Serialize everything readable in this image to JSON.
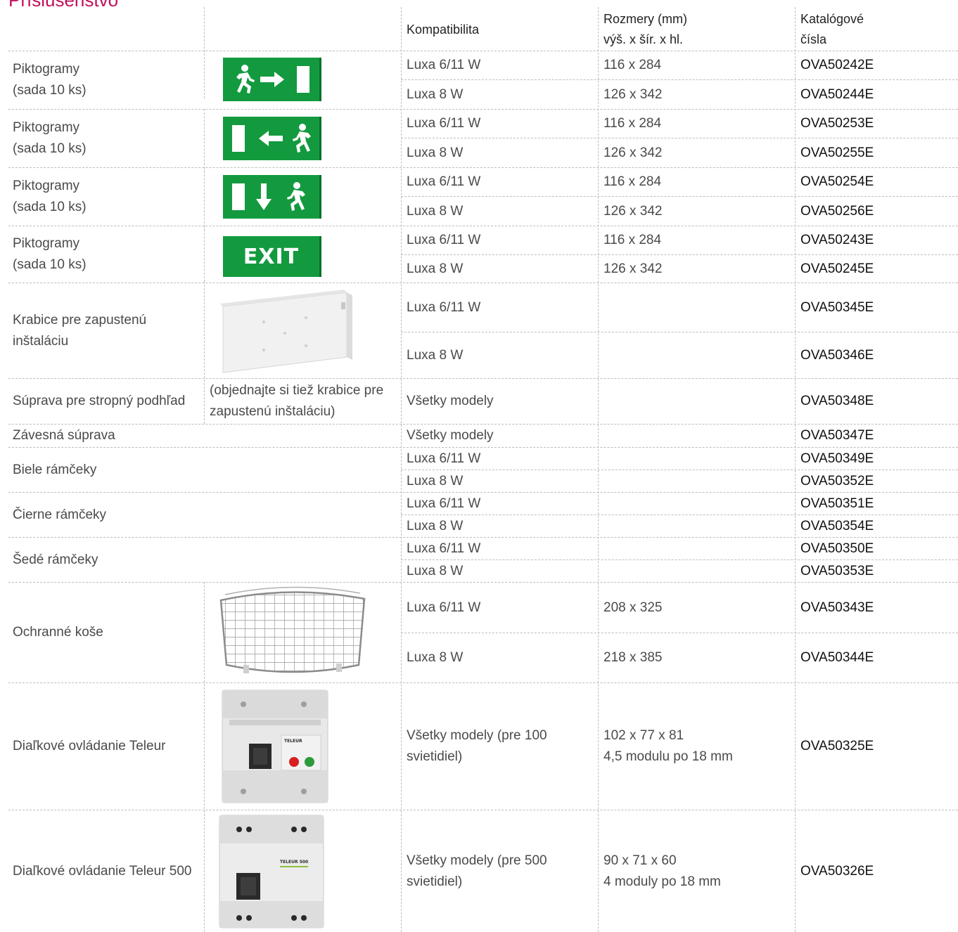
{
  "heading": "Príslušenstvo",
  "colors": {
    "accent": "#c4105a",
    "sign_green": "#139a3f"
  },
  "headers": {
    "compat": "Kompatibilita",
    "dims_line1": "Rozmery (mm)",
    "dims_line2": "výš. x šír. x hl.",
    "cat_line1": "Katalógové",
    "cat_line2": "čísla"
  },
  "groups": {
    "pict_right": {
      "name": "Piktogramy\n(sada 10 ks)",
      "icon": "exit-sign-run-right-icon",
      "rows": [
        {
          "compat": "Luxa 6/11 W",
          "dims": "116 x 284",
          "code": "OVA50242E"
        },
        {
          "compat": "Luxa 8 W",
          "dims": "126 x 342",
          "code": "OVA50244E"
        }
      ]
    },
    "pict_left": {
      "name": "Piktogramy\n(sada 10 ks)",
      "icon": "exit-sign-run-left-icon",
      "rows": [
        {
          "compat": "Luxa 6/11 W",
          "dims": "116 x 284",
          "code": "OVA50253E"
        },
        {
          "compat": "Luxa 8 W",
          "dims": "126 x 342",
          "code": "OVA50255E"
        }
      ]
    },
    "pict_down": {
      "name": "Piktogramy\n(sada 10 ks)",
      "icon": "exit-sign-down-icon",
      "rows": [
        {
          "compat": "Luxa 6/11 W",
          "dims": "116 x 284",
          "code": "OVA50254E"
        },
        {
          "compat": "Luxa 8 W",
          "dims": "126 x 342",
          "code": "OVA50256E"
        }
      ]
    },
    "pict_exit": {
      "name": "Piktogramy\n(sada 10 ks)",
      "sign_text": "EXIT",
      "rows": [
        {
          "compat": "Luxa 6/11 W",
          "dims": "116 x 284",
          "code": "OVA50243E"
        },
        {
          "compat": "Luxa 8 W",
          "dims": "126 x 342",
          "code": "OVA50245E"
        }
      ]
    },
    "krabice": {
      "name": "Krabice pre zapustenú\ninštaláciu",
      "rows": [
        {
          "compat": "Luxa 6/11 W",
          "code": "OVA50345E"
        },
        {
          "compat": "Luxa 8 W",
          "code": "OVA50346E"
        }
      ]
    },
    "strop": {
      "name": "Súprava pre stropný podhľad",
      "note": "(objednajte si tiež krabice pre\nzapustenú inštaláciu)",
      "compat": "Všetky modely",
      "code": "OVA50348E"
    },
    "zaves": {
      "name": "Závesná súprava",
      "compat": "Všetky modely",
      "code": "OVA50347E"
    },
    "biele": {
      "name": "Biele rámčeky",
      "rows": [
        {
          "compat": "Luxa 6/11 W",
          "code": "OVA50349E"
        },
        {
          "compat": "Luxa 8 W",
          "code": "OVA50352E"
        }
      ]
    },
    "cierne": {
      "name": "Čierne rámčeky",
      "rows": [
        {
          "compat": "Luxa 6/11 W",
          "code": "OVA50351E"
        },
        {
          "compat": "Luxa 8 W",
          "code": "OVA50354E"
        }
      ]
    },
    "sede": {
      "name": "Šedé rámčeky",
      "rows": [
        {
          "compat": "Luxa 6/11 W",
          "code": "OVA50350E"
        },
        {
          "compat": "Luxa 8 W",
          "code": "OVA50353E"
        }
      ]
    },
    "kose": {
      "name": "Ochranné koše",
      "rows": [
        {
          "compat": "Luxa 6/11 W",
          "dims": "208 x 325",
          "code": "OVA50343E"
        },
        {
          "compat": "Luxa 8 W",
          "dims": "218 x 385",
          "code": "OVA50344E"
        }
      ]
    },
    "teleur": {
      "name": "Diaľkové ovládanie Teleur",
      "compat": "Všetky modely (pre 100\nsvietidiel)",
      "dims": "102 x 77 x 81\n4,5 modulu po 18 mm",
      "code": "OVA50325E",
      "device_label": "TELEUR"
    },
    "teleur500": {
      "name": "Diaľkové ovládanie Teleur 500",
      "compat": "Všetky modely (pre 500\nsvietidiel)",
      "dims": "90 x 71 x 60\n4 moduly po 18 mm",
      "code": "OVA50326E",
      "device_label": "TELEUR 500"
    }
  }
}
